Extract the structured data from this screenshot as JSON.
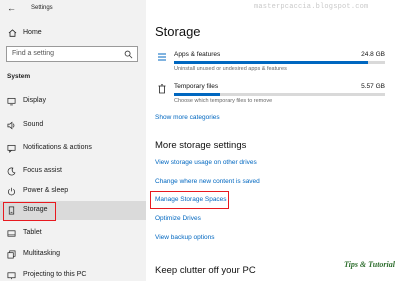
{
  "window": {
    "title": "Settings"
  },
  "sidebar": {
    "home_label": "Home",
    "search": {
      "placeholder": "Find a setting"
    },
    "section_label": "System",
    "items": [
      {
        "label": "Display",
        "icon": "display-icon"
      },
      {
        "label": "Sound",
        "icon": "sound-icon"
      },
      {
        "label": "Notifications & actions",
        "icon": "notifications-icon"
      },
      {
        "label": "Focus assist",
        "icon": "focus-assist-icon"
      },
      {
        "label": "Power & sleep",
        "icon": "power-icon"
      },
      {
        "label": "Storage",
        "icon": "storage-icon",
        "selected": true
      },
      {
        "label": "Tablet",
        "icon": "tablet-icon"
      },
      {
        "label": "Multitasking",
        "icon": "multitasking-icon"
      },
      {
        "label": "Projecting to this PC",
        "icon": "projecting-icon"
      }
    ]
  },
  "main": {
    "title": "Storage",
    "storage": [
      {
        "name": "Apps & features",
        "size": "24.8 GB",
        "description": "Uninstall unused or undesired apps & features",
        "usage_fraction": 0.92,
        "icon": "apps-icon"
      },
      {
        "name": "Temporary files",
        "size": "5.57 GB",
        "description": "Choose which temporary files to remove",
        "usage_fraction": 0.22,
        "icon": "trash-icon"
      }
    ],
    "show_more_link": "Show more categories",
    "more_settings": {
      "heading": "More storage settings",
      "links": [
        "View storage usage on other drives",
        "Change where new content is saved",
        "Manage Storage Spaces",
        "Optimize Drives",
        "View backup options"
      ]
    },
    "keep_clutter_heading": "Keep clutter off your PC"
  },
  "watermarks": {
    "top": "masterpcaccia.blogspot.com",
    "bottom": "Tips & Tutorial"
  },
  "colors": {
    "accent": "#0067c0",
    "highlight": "#e8191f",
    "sidebar_bg": "#f2f2f2"
  }
}
